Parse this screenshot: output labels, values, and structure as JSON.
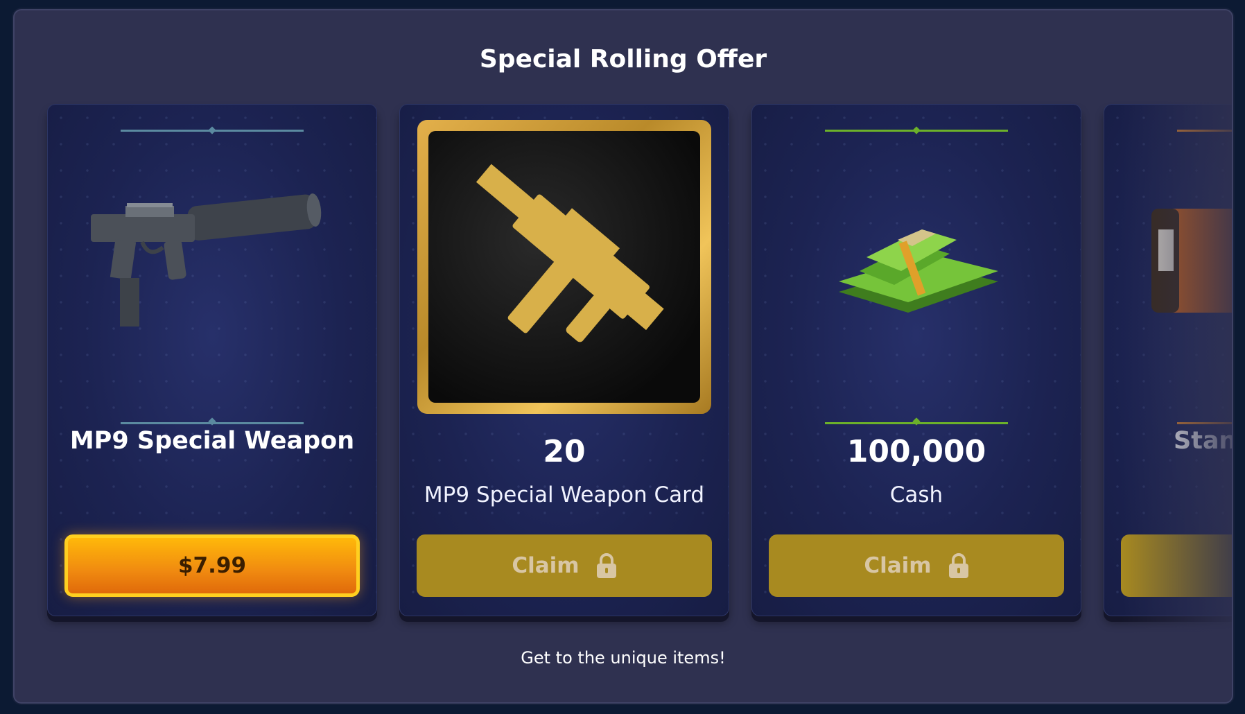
{
  "offer": {
    "title": "Special Rolling Offer",
    "footer_text": "Get to the unique items!"
  },
  "cards": [
    {
      "name": "MP9 Special Weapon",
      "button_label": "$7.99",
      "accent": "#5b8aa0",
      "image_icon": "mp9-weapon-icon"
    },
    {
      "quantity": "20",
      "label": "MP9 Special Weapon Card",
      "button_label": "Claim",
      "button_icon": "lock-icon",
      "image_icon": "mp9-weapon-card-icon"
    },
    {
      "quantity": "100,000",
      "label": "Cash",
      "button_label": "Claim",
      "button_icon": "lock-icon",
      "accent": "#6cb12a",
      "image_icon": "cash-stack-icon"
    },
    {
      "name": "Stan",
      "accent": "#e0862a",
      "image_icon": "orange-case-icon"
    }
  ],
  "colors": {
    "panel_bg": "#2f3150",
    "price_button": "#f39c12",
    "claim_button": "#a88a20"
  }
}
